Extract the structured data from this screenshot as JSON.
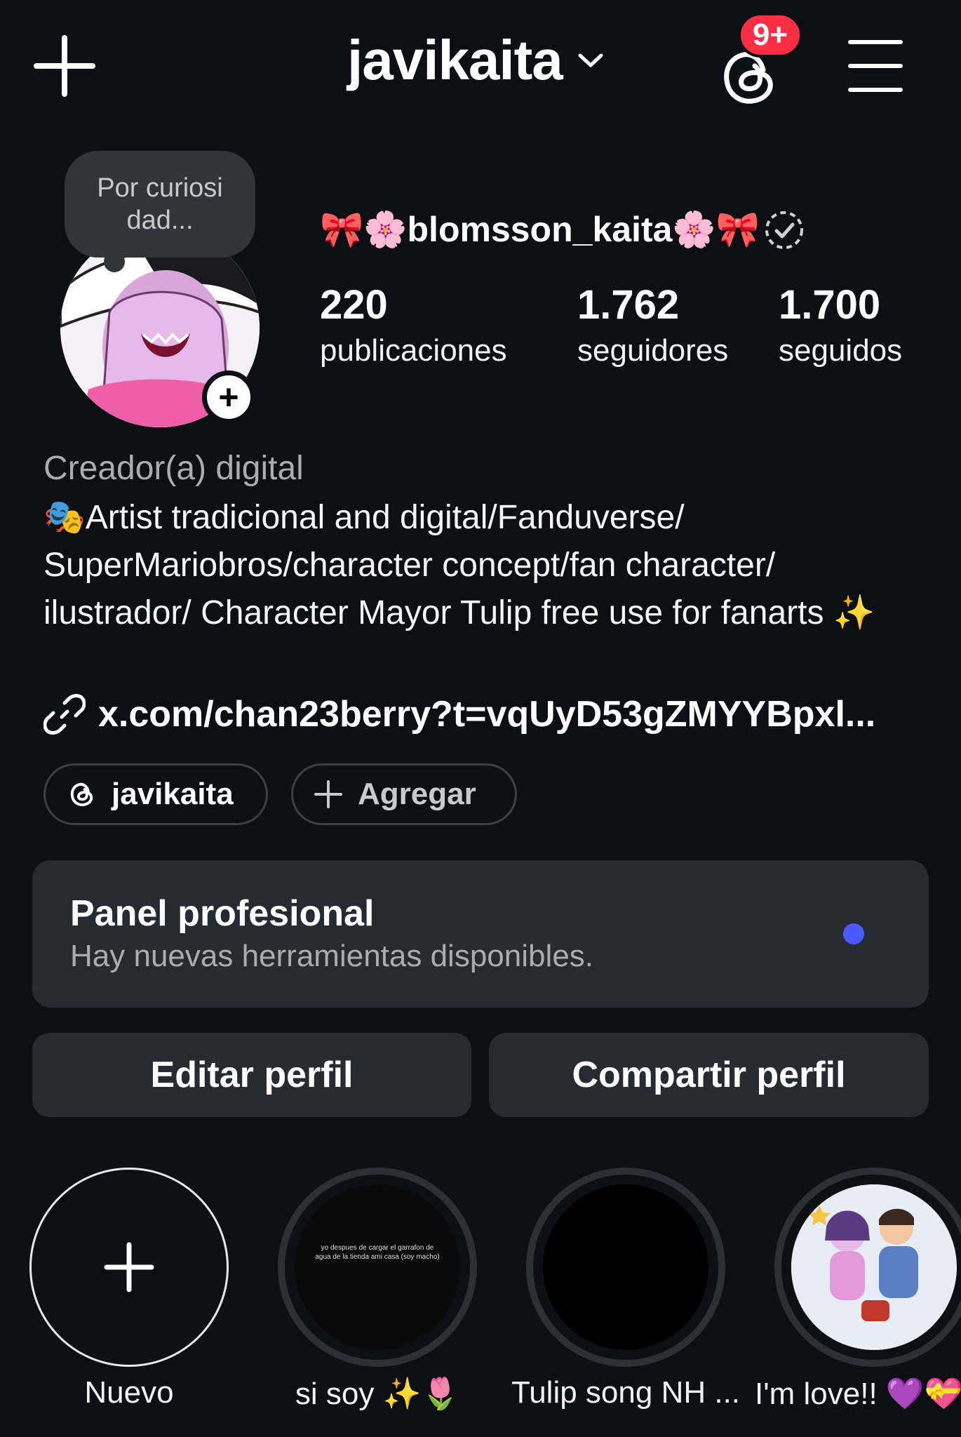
{
  "header": {
    "username": "javikaita",
    "notification_badge": "9+",
    "icons": [
      "plus-icon",
      "chevron-down-icon",
      "threads-icon",
      "menu-icon"
    ]
  },
  "profile": {
    "note": "Por curiosi\ndad...",
    "display_name": "🎀🌸blomsson_kaita🌸🎀",
    "stats": [
      {
        "value": "220",
        "label": "publicaciones"
      },
      {
        "value": "1.762",
        "label": "seguidores"
      },
      {
        "value": "1.700",
        "label": "seguidos"
      }
    ],
    "category": "Creador(a) digital",
    "bio": "🎭Artist tradicional and digital/Fanduverse/ SuperMariobros/character concept/fan character/ ilustrador/ Character Mayor Tulip free use for fanarts ✨",
    "link": "x.com/chan23berry?t=vqUyD53gZMYYBpxl..."
  },
  "pills": {
    "threads_label": "javikaita",
    "add_label": "Agregar"
  },
  "panel": {
    "title": "Panel profesional",
    "subtitle": "Hay nuevas herramientas disponibles.",
    "dot_color": "#4a5cff"
  },
  "buttons": {
    "edit": "Editar perfil",
    "share": "Compartir perfil"
  },
  "highlights": [
    {
      "label": "Nuevo"
    },
    {
      "label": "si soy ✨🌷",
      "story_text": "yo despues de cargar el garrafon de agua de la tienda ami casa (soy macho)"
    },
    {
      "label": "Tulip song NH ..."
    },
    {
      "label": "I'm love!! 💜💝"
    }
  ],
  "colors": {
    "background": "#0c0f14",
    "card": "#262a31",
    "badge": "#ff2e45",
    "accent_dot": "#4a5cff"
  }
}
